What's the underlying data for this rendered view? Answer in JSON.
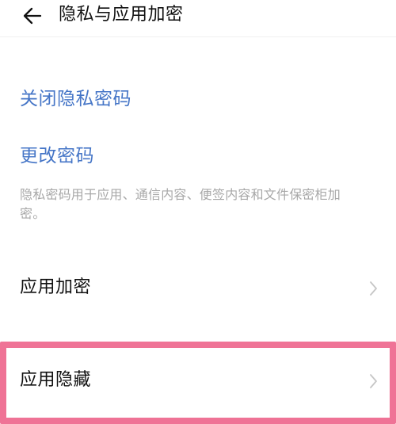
{
  "header": {
    "title": "隐私与应用加密",
    "back_icon": "arrow-left-icon"
  },
  "settings": {
    "close_privacy_password": "关闭隐私密码",
    "change_password": "更改密码",
    "description": "隐私密码用于应用、通信内容、便签内容和文件保密柜加密。"
  },
  "menu": {
    "items": [
      {
        "label": "应用加密",
        "icon": "chevron-right-icon"
      },
      {
        "label": "应用隐藏",
        "icon": "chevron-right-icon"
      }
    ]
  },
  "colors": {
    "link": "#4676c7",
    "description": "#a8a8a8",
    "primary_text": "#111111",
    "chevron": "#c6c6c6",
    "highlight": "#ef7396"
  }
}
